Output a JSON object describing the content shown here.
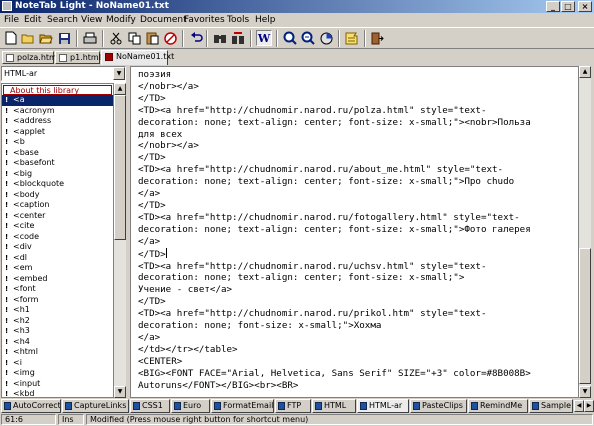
{
  "window": {
    "title": "NoteTab Light - NoName01.txt"
  },
  "menu": [
    "File",
    "Edit",
    "Search",
    "View",
    "Modify",
    "Document",
    "Favorites",
    "Tools",
    "Help"
  ],
  "toolbar": {
    "icons": [
      "new-file-icon",
      "open-file-icon",
      "open-folder-icon",
      "save-icon",
      "print-icon",
      "cut-icon",
      "copy-icon",
      "paste-icon",
      "clear-icon",
      "undo-icon",
      "find-icon",
      "replace-icon",
      "word-wrap-icon",
      "zoom-in-icon",
      "zoom-out-icon",
      "text-statistics-icon",
      "clipbook-icon",
      "exit-icon"
    ],
    "wrap_glyph": "W"
  },
  "doc_tabs": [
    {
      "label": "polza.html",
      "active": false
    },
    {
      "label": "p1.html",
      "active": false
    },
    {
      "label": "NoName01.txt",
      "active": true
    }
  ],
  "library": {
    "selected": "HTML-ar",
    "header": "About this library",
    "items": [
      "<a",
      "<acronym",
      "<address",
      "<applet",
      "<b",
      "<base",
      "<basefont",
      "<big",
      "<blockquote",
      "<body",
      "<caption",
      "<center",
      "<cite",
      "<code",
      "<div",
      "<dl",
      "<em",
      "<embed",
      "<font",
      "<form",
      "<h1",
      "<h2",
      "<h3",
      "<h4",
      "<html",
      "<i",
      "<img",
      "<input",
      "<kbd",
      "<li"
    ],
    "selected_index": 0
  },
  "editor": {
    "lines": [
      "поэзия",
      "</nobr></a>",
      "</TD>",
      "<TD><a href=\"http://chudnomir.narod.ru/polza.html\" style=\"text-",
      "decoration: none; text-align: center; font-size: x-small;\"><nobr>Польза",
      "для всех",
      "</nobr></a>",
      "</TD>",
      "<TD><a href=\"http://chudnomir.narod.ru/about_me.html\" style=\"text-",
      "decoration: none; text-align: center; font-size: x-small;\">Про chudo",
      "</a>",
      "</TD>",
      "<TD><a href=\"http://chudnomir.narod.ru/fotogallery.html\" style=\"text-",
      "decoration: none; text-align: center; font-size: x-small;\">Фото галерея",
      "</a>",
      "</TD>",
      "<TD><a href=\"http://chudnomir.narod.ru/uchsv.html\" style=\"text-",
      "decoration: none; text-align: center; font-size: x-small;\">",
      "Учение - свет</a>",
      "</TD>",
      "<TD><a href=\"http://chudnomir.narod.ru/prikol.htm\" style=\"text-",
      "decoration: none; font-size: x-small;\">Хохма",
      "</a>",
      "</td></tr></table>",
      "<CENTER>",
      "<BIG><FONT FACE=\"Arial, Helvetica, Sans Serif\" SIZE=\"+3\" color=#8B008B>",
      "Autoruns</FONT></BIG><br><BR>"
    ],
    "caret_line": 15
  },
  "clip_tabs": [
    {
      "label": "AutoCorrect",
      "active": false
    },
    {
      "label": "CaptureLinks",
      "active": false
    },
    {
      "label": "CSS1",
      "active": false
    },
    {
      "label": "Euro",
      "active": false
    },
    {
      "label": "FormatEmail",
      "active": false
    },
    {
      "label": "FTP",
      "active": false
    },
    {
      "label": "HTML",
      "active": false
    },
    {
      "label": "HTML-ar",
      "active": true
    },
    {
      "label": "PasteClips",
      "active": false
    },
    {
      "label": "RemindMe",
      "active": false
    },
    {
      "label": "Sample",
      "active": false
    }
  ],
  "status": {
    "position": "61:6",
    "mode": "Ins",
    "message": "Modified  (Press mouse right button for shortcut menu)"
  }
}
